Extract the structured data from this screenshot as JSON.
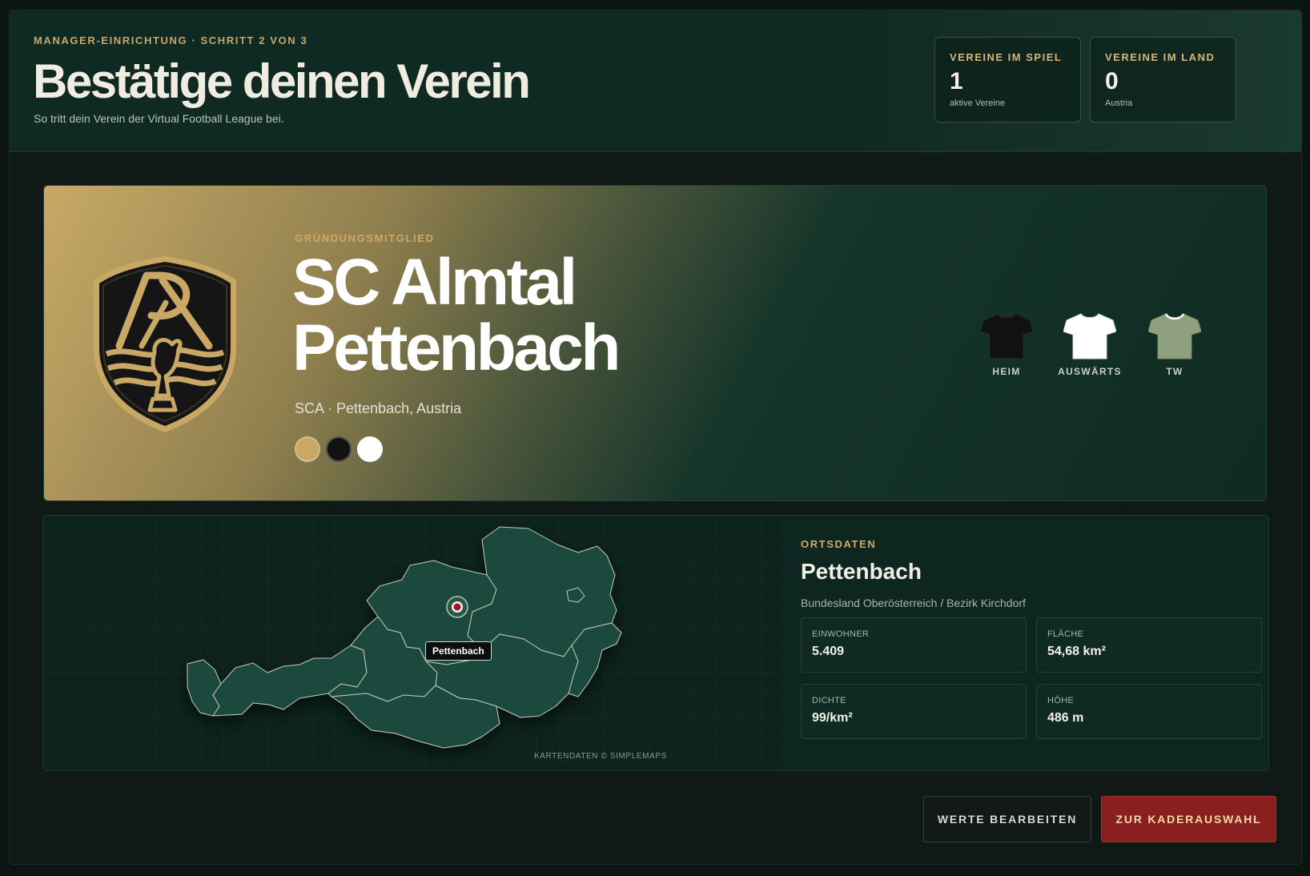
{
  "header": {
    "eyebrow": "MANAGER-EINRICHTUNG · SCHRITT 2 VON 3",
    "title": "Bestätige deinen Verein",
    "subtitle": "So tritt dein Verein der Virtual Football League bei.",
    "stats": [
      {
        "label": "VEREINE IM SPIEL",
        "value": "1",
        "sub": "aktive Vereine"
      },
      {
        "label": "VEREINE IM LAND",
        "value": "0",
        "sub": "Austria"
      }
    ]
  },
  "club": {
    "badge": "GRÜNDUNGSMITGLIED",
    "name": "SC Almtal Pettenbach",
    "meta": "SCA · Pettenbach, Austria",
    "colors": [
      "#c9a764",
      "#121212",
      "#ffffff"
    ],
    "kits": [
      {
        "label": "HEIM",
        "color": "#111111"
      },
      {
        "label": "AUSWÄRTS",
        "color": "#ffffff"
      },
      {
        "label": "TW",
        "color": "#8fa07f"
      }
    ],
    "crest_icon": "club-crest-icon"
  },
  "location": {
    "section_label": "ORTSDATEN",
    "place": "Pettenbach",
    "region": "Bundesland Oberösterreich / Bezirk Kirchdorf",
    "pin_label": "Pettenbach",
    "map_credit": "KARTENDATEN © SIMPLEMAPS",
    "facts": [
      {
        "label": "EINWOHNER",
        "value": "5.409"
      },
      {
        "label": "FLÄCHE",
        "value": "54,68 km²"
      },
      {
        "label": "DICHTE",
        "value": "99/km²"
      },
      {
        "label": "HÖHE",
        "value": "486 m"
      }
    ]
  },
  "actions": {
    "edit_label": "WERTE BEARBEITEN",
    "next_label": "ZUR KADERAUSWAHL"
  }
}
